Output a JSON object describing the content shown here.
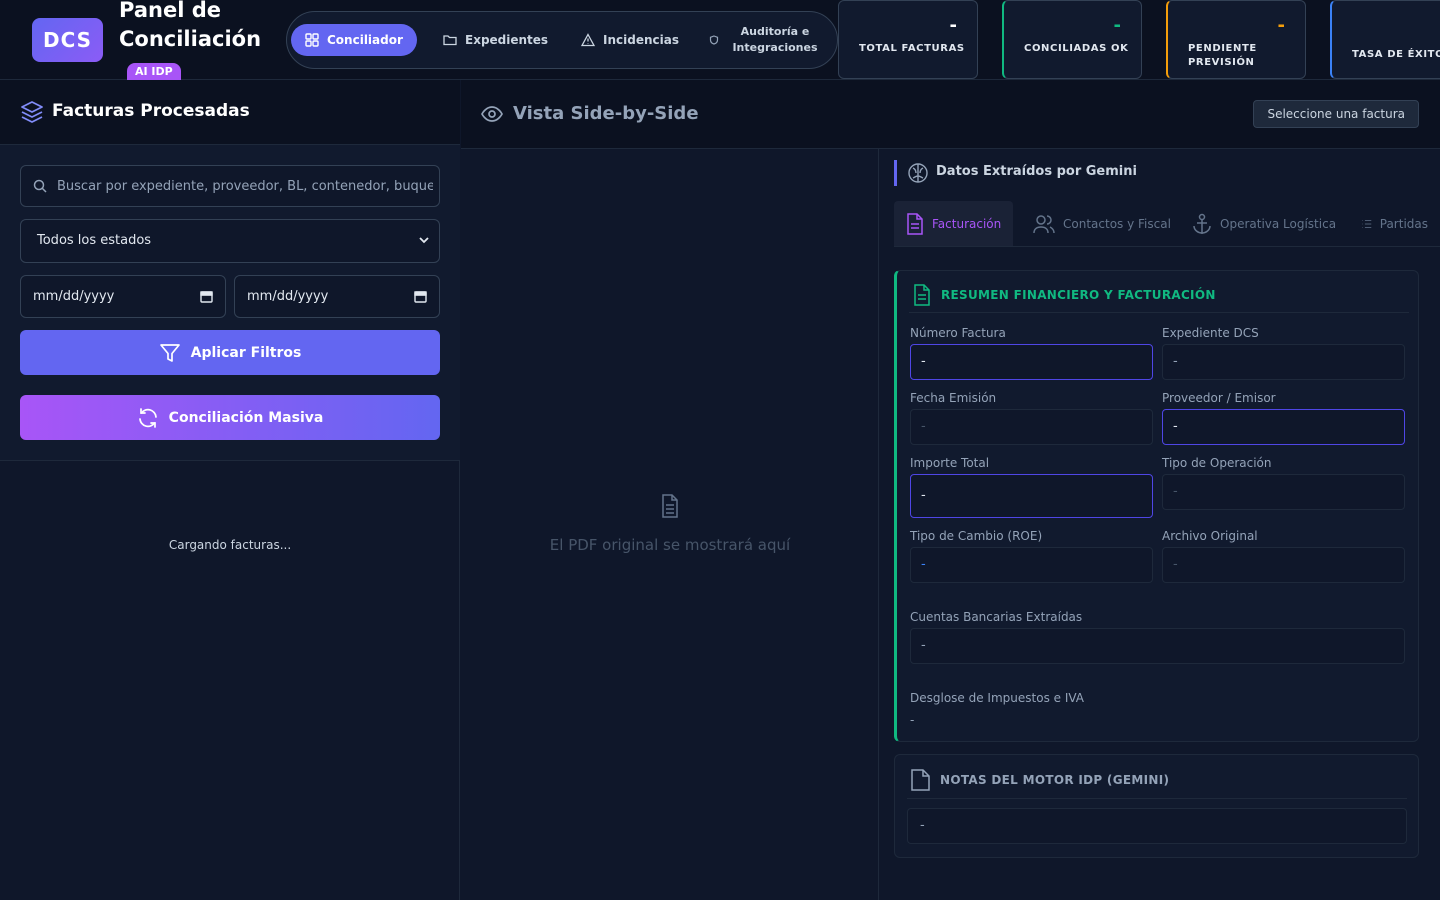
{
  "brand": {
    "logo": "DCS",
    "title": "Panel de Conciliación",
    "badge": "AI IDP"
  },
  "nav": {
    "items": [
      {
        "label": "Conciliador",
        "icon": "grid-icon",
        "active": true
      },
      {
        "label": "Expedientes",
        "icon": "folder-icon",
        "active": false
      },
      {
        "label": "Incidencias",
        "icon": "warning-triangle-icon",
        "active": false
      },
      {
        "label": "Auditoría e Integraciones",
        "icon": "shield-icon",
        "active": false
      }
    ]
  },
  "kpis": [
    {
      "label": "TOTAL FACTURAS",
      "value": "-",
      "accent": "#334155",
      "value_color": "#ffffff"
    },
    {
      "label": "CONCILIADAS OK",
      "value": "-",
      "accent": "#10b981",
      "value_color": "#10b981"
    },
    {
      "label": "PENDIENTE PREVISIÓN",
      "value": "-",
      "accent": "#f59e0b",
      "value_color": "#f59e0b"
    },
    {
      "label": "TASA DE ÉXITO",
      "value": "",
      "accent": "#3b82f6",
      "value_color": "#3b82f6"
    }
  ],
  "left_panel": {
    "title": "Facturas Procesadas",
    "search_placeholder": "Buscar por expediente, proveedor, BL, contenedor, buque...",
    "status_select": "Todos los estados",
    "date_from": "mm/dd/yyyy",
    "date_to": "mm/dd/yyyy",
    "apply_button": "Aplicar Filtros",
    "mass_button": "Conciliación Masiva",
    "loading_text": "Cargando facturas..."
  },
  "center": {
    "title": "Vista Side-by-Side",
    "select_pill": "Seleccione una factura",
    "pdf_placeholder": "El PDF original se mostrará aquí"
  },
  "extracted": {
    "title": "Datos Extraídos por Gemini",
    "tabs": [
      {
        "label": "Facturación",
        "icon": "document-icon",
        "active": true
      },
      {
        "label": "Contactos y Fiscal",
        "icon": "users-icon",
        "active": false
      },
      {
        "label": "Operativa Logística",
        "icon": "anchor-icon",
        "active": false
      },
      {
        "label": "Partidas",
        "icon": "list-icon",
        "active": false
      }
    ],
    "card": {
      "title": "RESUMEN FINANCIERO Y FACTURACIÓN",
      "fields": [
        {
          "label": "Número Factura",
          "value": "-"
        },
        {
          "label": "Expediente DCS",
          "value": "-"
        },
        {
          "label": "Fecha Emisión",
          "value": "-"
        },
        {
          "label": "Proveedor / Emisor",
          "value": "-"
        },
        {
          "label": "Importe Total",
          "value": "-"
        },
        {
          "label": "Tipo de Operación",
          "value": "-"
        },
        {
          "label": "Tipo de Cambio (ROE)",
          "value": "-"
        },
        {
          "label": "Archivo Original",
          "value": "-"
        },
        {
          "label": "Cuentas Bancarias Extraídas",
          "value": "-"
        },
        {
          "label": "Desglose de Impuestos e IVA",
          "value": "-"
        }
      ]
    },
    "notes": {
      "title": "NOTAS DEL MOTOR IDP (GEMINI)",
      "value": "-"
    }
  }
}
